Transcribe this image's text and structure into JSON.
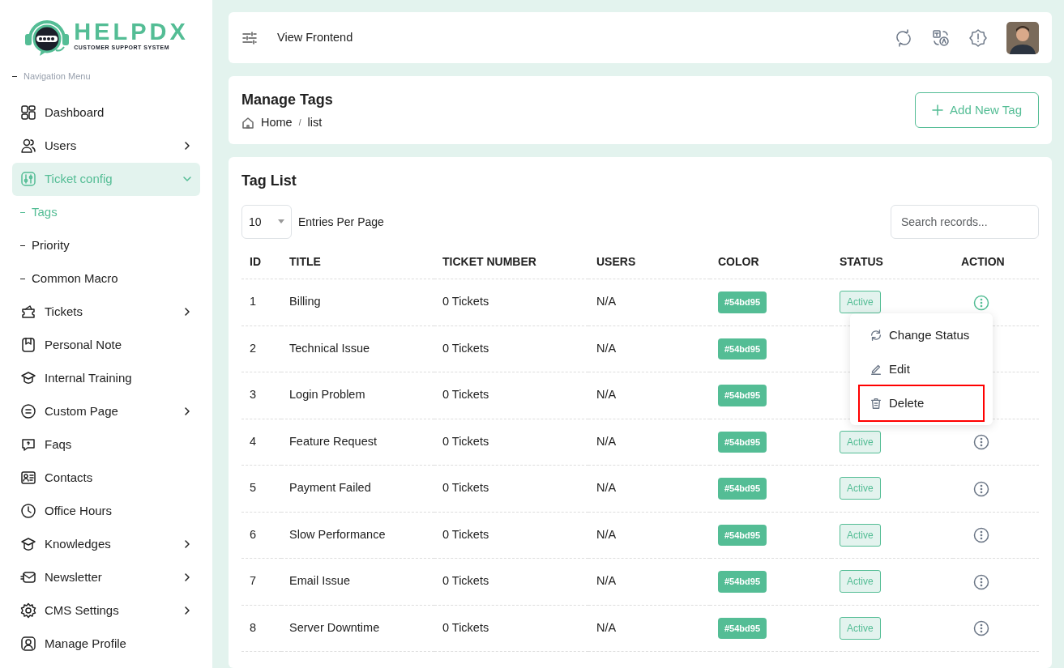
{
  "brand": {
    "name": "HELPDX",
    "tagline": "CUSTOMER SUPPORT SYSTEM"
  },
  "sidebar": {
    "heading": "Navigation Menu",
    "items": [
      {
        "label": "Dashboard",
        "has_submenu": false,
        "selected": false
      },
      {
        "label": "Users",
        "has_submenu": true,
        "expanded": false,
        "selected": false
      },
      {
        "label": "Ticket config",
        "has_submenu": true,
        "expanded": true,
        "selected": true,
        "children": [
          {
            "label": "Tags",
            "selected": true
          },
          {
            "label": "Priority",
            "selected": false
          },
          {
            "label": "Common Macro",
            "selected": false
          }
        ]
      },
      {
        "label": "Tickets",
        "has_submenu": true,
        "expanded": false,
        "selected": false
      },
      {
        "label": "Personal Note",
        "has_submenu": false,
        "selected": false
      },
      {
        "label": "Internal Training",
        "has_submenu": false,
        "selected": false
      },
      {
        "label": "Custom Page",
        "has_submenu": true,
        "expanded": false,
        "selected": false
      },
      {
        "label": "Faqs",
        "has_submenu": false,
        "selected": false
      },
      {
        "label": "Contacts",
        "has_submenu": false,
        "selected": false
      },
      {
        "label": "Office Hours",
        "has_submenu": false,
        "selected": false
      },
      {
        "label": "Knowledges",
        "has_submenu": true,
        "expanded": false,
        "selected": false
      },
      {
        "label": "Newsletter",
        "has_submenu": true,
        "expanded": false,
        "selected": false
      },
      {
        "label": "CMS Settings",
        "has_submenu": true,
        "expanded": false,
        "selected": false
      },
      {
        "label": "Manage Profile",
        "has_submenu": false,
        "selected": false
      }
    ]
  },
  "topbar": {
    "link": "View Frontend"
  },
  "page_header": {
    "title": "Manage Tags",
    "breadcrumb": [
      "Home",
      "list"
    ],
    "breadcrumb_separator": "/",
    "button": "Add New Tag"
  },
  "tag_list": {
    "title": "Tag List",
    "entries": "10",
    "entries_label": "Entries Per Page",
    "search": {
      "placeholder": "Search records..."
    },
    "columns": [
      "ID",
      "TITLE",
      "TICKET NUMBER",
      "USERS",
      "COLOR",
      "STATUS",
      "ACTION"
    ],
    "rows": [
      {
        "id": "1",
        "title": "Billing",
        "tickets": "0 Tickets",
        "users": "N/A",
        "color": "#54bd95",
        "color_label": "#54bd95",
        "status": "Active",
        "menu_open": true
      },
      {
        "id": "2",
        "title": "Technical Issue",
        "tickets": "0 Tickets",
        "users": "N/A",
        "color": "#54bd95",
        "color_label": "#54bd95"
      },
      {
        "id": "3",
        "title": "Login Problem",
        "tickets": "0 Tickets",
        "users": "N/A",
        "color": "#54bd95",
        "color_label": "#54bd95"
      },
      {
        "id": "4",
        "title": "Feature Request",
        "tickets": "0 Tickets",
        "users": "N/A",
        "color": "#54bd95",
        "color_label": "#54bd95",
        "status": "Active",
        "menu_open": false
      },
      {
        "id": "5",
        "title": "Payment Failed",
        "tickets": "0 Tickets",
        "users": "N/A",
        "color": "#54bd95",
        "color_label": "#54bd95",
        "status": "Active",
        "menu_open": false
      },
      {
        "id": "6",
        "title": "Slow Performance",
        "tickets": "0 Tickets",
        "users": "N/A",
        "color": "#54bd95",
        "color_label": "#54bd95",
        "status": "Active",
        "menu_open": false
      },
      {
        "id": "7",
        "title": "Email Issue",
        "tickets": "0 Tickets",
        "users": "N/A",
        "color": "#54bd95",
        "color_label": "#54bd95",
        "status": "Active",
        "menu_open": false
      },
      {
        "id": "8",
        "title": "Server Downtime",
        "tickets": "0 Tickets",
        "users": "N/A",
        "color": "#54bd95",
        "color_label": "#54bd95",
        "status": "Active",
        "menu_open": false
      }
    ],
    "action_menu": [
      {
        "label": "Change Status",
        "highlighted": false
      },
      {
        "label": "Edit",
        "highlighted": false
      },
      {
        "label": "Delete",
        "highlighted": true
      }
    ]
  }
}
